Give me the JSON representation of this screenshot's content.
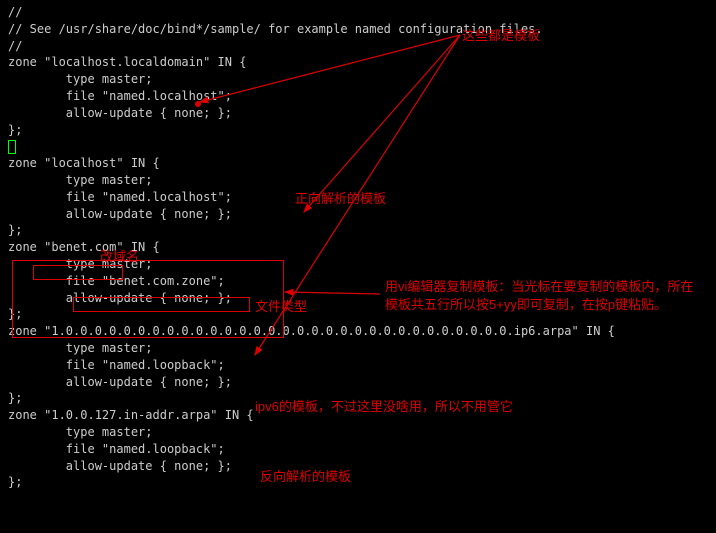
{
  "code": {
    "l1": "//",
    "l2": "// See /usr/share/doc/bind*/sample/ for example named configuration files.",
    "l3": "//",
    "l4": "",
    "l5": "zone \"localhost.localdomain\" IN {",
    "l6": "        type master;",
    "l7": "        file \"named.localhost\";",
    "l8": "        allow-update { none; };",
    "l9": "};",
    "l11": "zone \"localhost\" IN {",
    "l12": "        type master;",
    "l13": "        file \"named.localhost\";",
    "l14": "        allow-update { none; };",
    "l15": "};",
    "l16": "",
    "l17": "zone \"benet.com\" IN {",
    "l18": "        type master;",
    "l19": "        file \"benet.com.zone\";",
    "l20": "        allow-update { none; };",
    "l21": "};",
    "l22": "",
    "l23": "zone \"1.0.0.0.0.0.0.0.0.0.0.0.0.0.0.0.0.0.0.0.0.0.0.0.0.0.0.0.0.0.0.0.ip6.arpa\" IN {",
    "l24": "        type master;",
    "l25": "        file \"named.loopback\";",
    "l26": "        allow-update { none; };",
    "l27": "};",
    "l28": "",
    "l29": "zone \"1.0.0.127.in-addr.arpa\" IN {",
    "l30": "        type master;",
    "l31": "        file \"named.loopback\";",
    "l32": "        allow-update { none; };",
    "l33": "};"
  },
  "annotations": {
    "top": "这些都是模板",
    "forward": "正向解析的模板",
    "domain": "改域名",
    "filetype": "文件类型",
    "vi": "用vi编辑器复制模板：当光标在要复制的模板内，所在模板共五行所以按5+yy即可复制，在按p键粘贴。",
    "ipv6": "ipv6的模板，不过这里没啥用，所以不用管它",
    "reverse": "反向解析的模板"
  }
}
